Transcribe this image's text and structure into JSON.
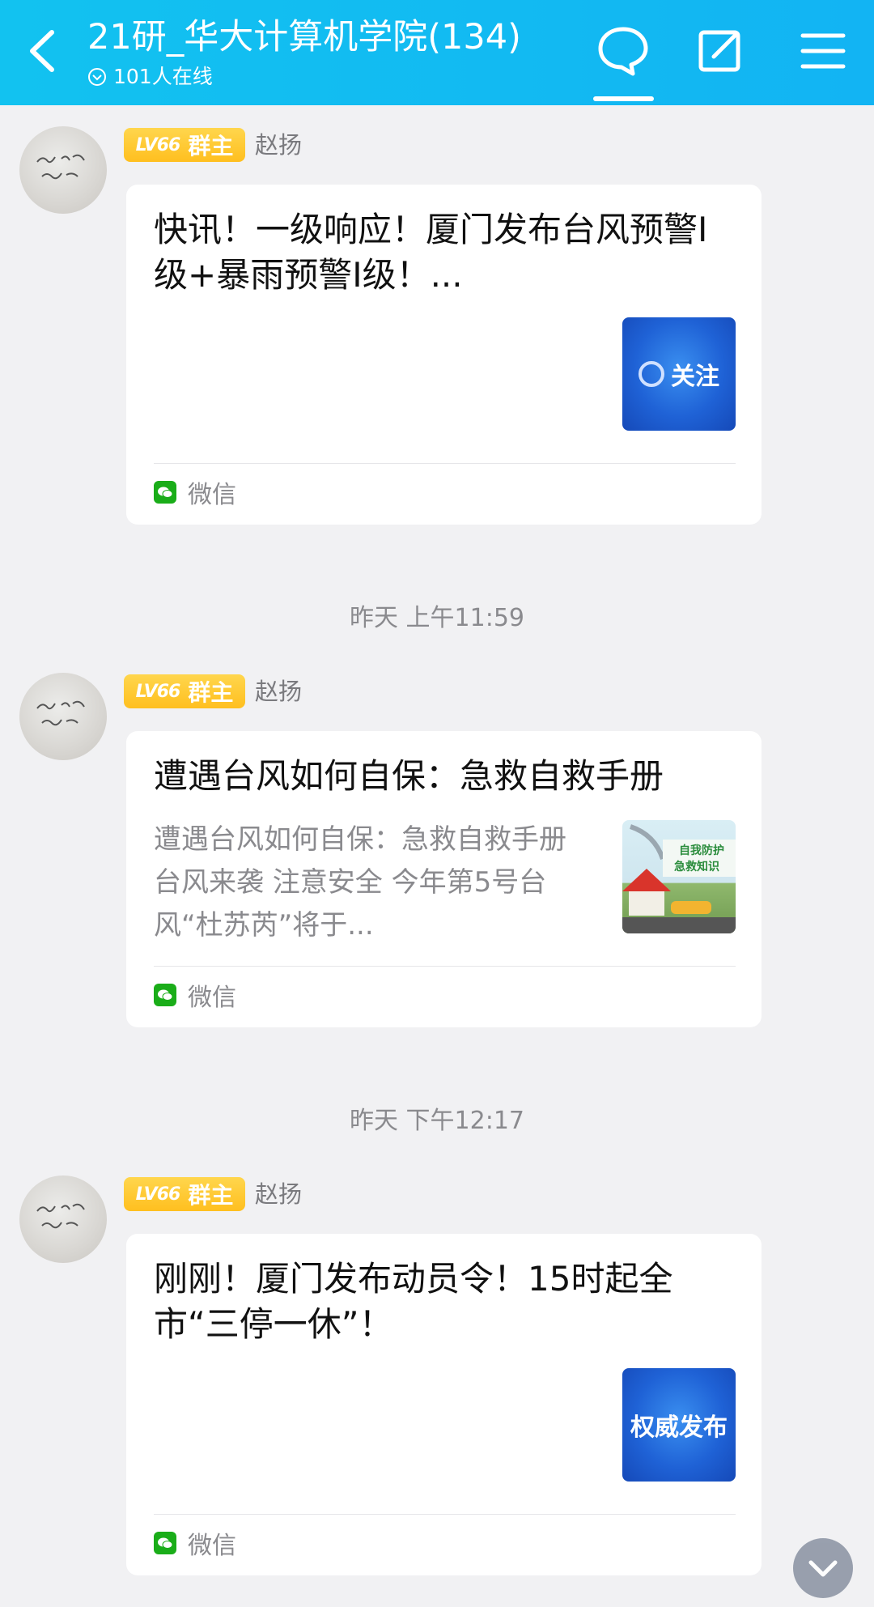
{
  "header": {
    "title": "21研_华大计算机学院(134)",
    "online": "101人在线",
    "icons": [
      "back-icon",
      "chat-bubble-icon",
      "edit-icon",
      "menu-icon"
    ]
  },
  "messages": [
    {
      "badge_level": "LV66",
      "badge_role": "群主",
      "sender": "赵扬",
      "title": "快讯！一级响应！厦门发布台风预警I级+暴雨预警I级！...",
      "desc": "",
      "thumb_text": "关注",
      "source": "微信"
    },
    {
      "badge_level": "LV66",
      "badge_role": "群主",
      "sender": "赵扬",
      "title": "遭遇台风如何自保：急救自救手册",
      "desc": "遭遇台风如何自保：急救自救手册台风来袭 注意安全 今年第5号台风“杜苏芮”将于...",
      "thumb_text": "自我防护 急救知识",
      "source": "微信"
    },
    {
      "badge_level": "LV66",
      "badge_role": "群主",
      "sender": "赵扬",
      "title": "刚刚！厦门发布动员令！15时起全市“三停一休”！",
      "desc": "",
      "thumb_text": "权威发布",
      "source": "微信"
    }
  ],
  "timestamps": [
    "昨天 上午11:59",
    "昨天 下午12:17"
  ],
  "colors": {
    "header": "#12b8f2",
    "badge": "#ffc928",
    "wechat": "#1aad19"
  }
}
